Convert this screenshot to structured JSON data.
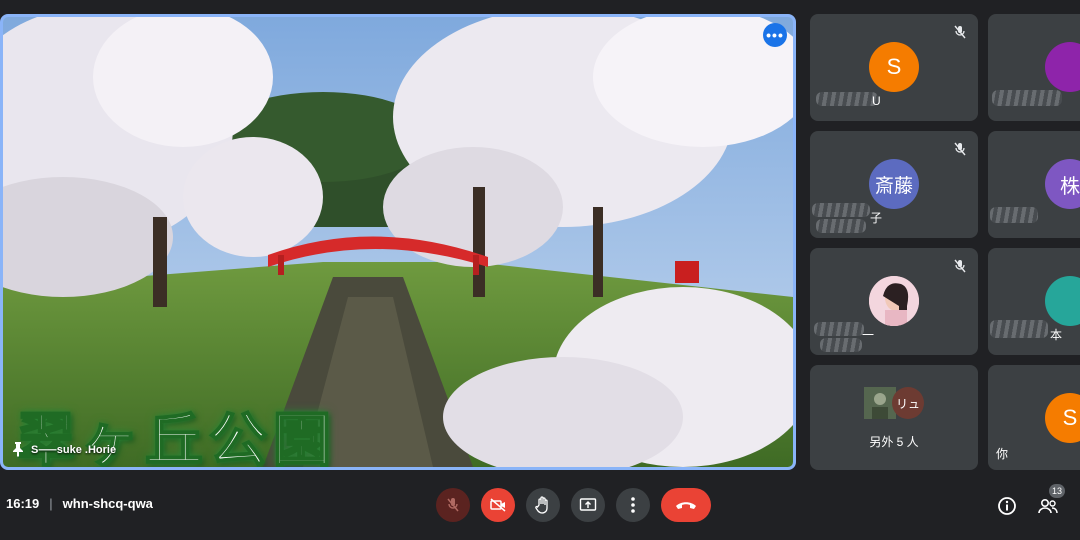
{
  "main": {
    "caption": "翠ヶ丘公園",
    "presenter_name": "S⸺suke .Horie",
    "more_icon": "more-horiz-icon",
    "pin_icon": "pin-icon"
  },
  "tiles": [
    {
      "initial": "S",
      "color": "#f57c00",
      "name": "U",
      "muted": true
    },
    {
      "initial": "",
      "color": "#8e24aa",
      "name": "",
      "muted": false
    },
    {
      "initial": "斎藤",
      "color": "#5c6bc0",
      "name": "子",
      "muted": true
    },
    {
      "initial": "株",
      "color": "#7e57c2",
      "name": "",
      "muted": false
    },
    {
      "initial": "",
      "color": "#f8bbd0",
      "name": "一",
      "muted": true
    },
    {
      "initial": "",
      "color": "#26a69a",
      "name": "本",
      "muted": false
    },
    {
      "others_label": "另外 5 人",
      "avatar2": "リュ"
    },
    {
      "initial": "S",
      "color": "#f57c00",
      "name": "你",
      "muted": false
    }
  ],
  "bottom": {
    "time": "16:19",
    "meeting_code": "whn-shcq-qwa",
    "participants_count": "13"
  },
  "colors": {
    "background": "#202124",
    "tile": "#3c4043",
    "accent": "#8ab4f8",
    "danger": "#ea4335"
  }
}
